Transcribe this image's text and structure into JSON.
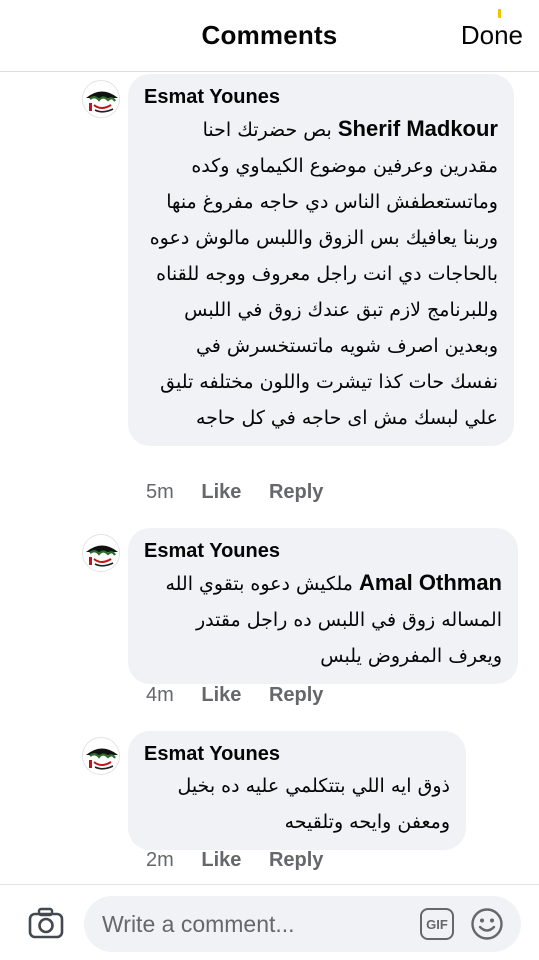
{
  "header": {
    "title": "Comments",
    "done_label": "Done"
  },
  "comments": [
    {
      "author": "Esmat Younes",
      "mention": "Sherif Madkour",
      "text": "بص حضرتك احنا مقدرين وعرفين موضوع الكيماوي وكده وماتستعطفش الناس دي حاجه مفروغ منها وربنا يعافيك بس الزوق واللبس مالوش دعوه بالحاجات دي انت راجل معروف ووجه للقناه وللبرنامج لازم تبق عندك زوق في اللبس وبعدين اصرف شويه ماتستخسرش في نفسك حات كذا تيشرت واللون مختلفه تليق علي لبسك مش اى حاجه في كل حاجه",
      "time": "5m",
      "like_label": "Like",
      "reply_label": "Reply"
    },
    {
      "author": "Esmat Younes",
      "mention": "Amal Othman",
      "text": "ملكيش دعوه بتقوي الله المساله زوق في اللبس ده راجل مقتدر ويعرف المفروض يلبس",
      "time": "4m",
      "like_label": "Like",
      "reply_label": "Reply"
    },
    {
      "author": "Esmat Younes",
      "mention": "",
      "text": "ذوق ايه اللي بتتكلمي عليه ده بخيل ومعفن وايحه وتلقيحه",
      "time": "2m",
      "like_label": "Like",
      "reply_label": "Reply"
    }
  ],
  "composer": {
    "placeholder": "Write a comment...",
    "gif_label": "GIF"
  },
  "icons": {
    "camera": "camera-icon",
    "gif": "gif-icon",
    "emoji": "emoji-icon",
    "avatar": "avatar"
  },
  "colors": {
    "bubble": "#f0f2f5",
    "meta": "#65676b",
    "text": "#050505"
  }
}
